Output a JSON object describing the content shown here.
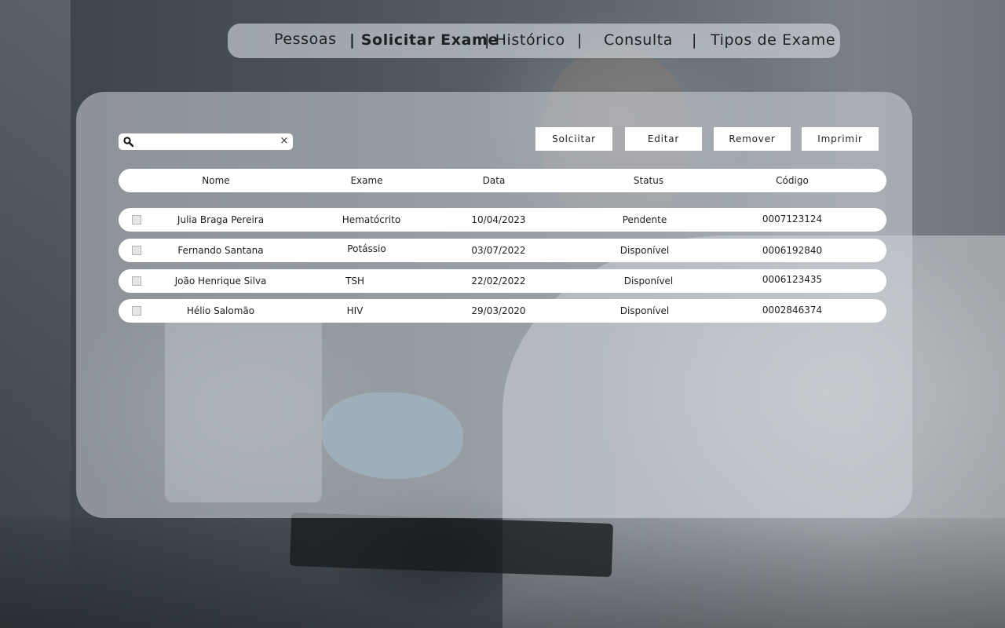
{
  "nav": {
    "items": [
      {
        "label": "Pessoas"
      },
      {
        "label": "| Solicitar Exame"
      },
      {
        "label": "| Histórico"
      },
      {
        "label": "|"
      },
      {
        "label": "Consulta"
      },
      {
        "label": "|"
      },
      {
        "label": "Tipos de Exame"
      }
    ]
  },
  "search": {
    "value": "",
    "clear_symbol": "×",
    "icon": "search-icon"
  },
  "toolbar": {
    "buttons": [
      {
        "label": "Solciitar"
      },
      {
        "label": "Editar"
      },
      {
        "label": "Remover"
      },
      {
        "label": "Imprimir"
      }
    ]
  },
  "table": {
    "columns": [
      "Nome",
      "Exame",
      "Data",
      "Status",
      "Código"
    ],
    "rows": [
      {
        "nome": "Julia Braga Pereira",
        "exame": "Hematócrito",
        "data": "10/04/2023",
        "status": "Pendente",
        "codigo": "0007123124",
        "checked": false
      },
      {
        "nome": "Fernando Santana",
        "exame": "Potássio",
        "data": "03/07/2022",
        "status": "Disponível",
        "codigo": "0006192840",
        "checked": false
      },
      {
        "nome": "João Henrique Silva",
        "exame": "TSH",
        "data": "22/02/2022",
        "status": "Disponível",
        "codigo": "0006123435",
        "checked": false
      },
      {
        "nome": "Hélio Salomão",
        "exame": "HIV",
        "data": "29/03/2020",
        "status": "Disponível",
        "codigo": "0002846374",
        "checked": false
      }
    ]
  },
  "colors": {
    "panel": "#cdd3d8",
    "nav": "#d7dce0",
    "text": "#1e1e1e"
  }
}
